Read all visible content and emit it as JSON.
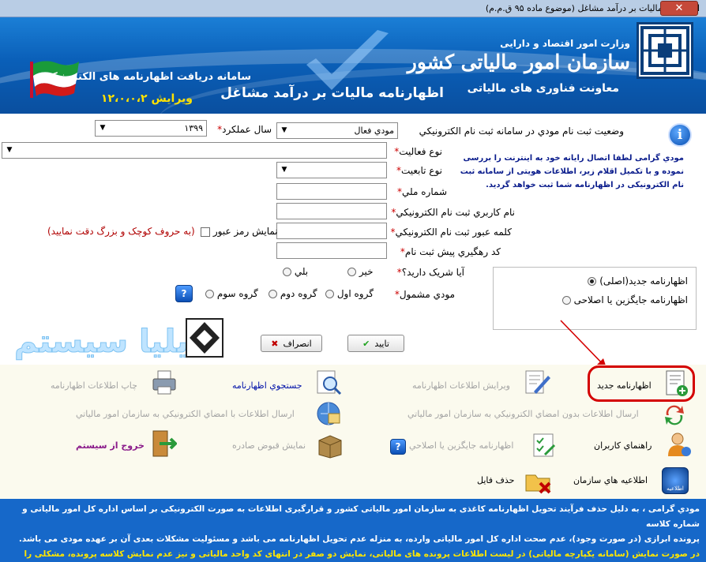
{
  "window": {
    "title": "اظهارنامه ماليات بر درآمد مشاغل (موضوع ماده ۹۵ ق.م.م)",
    "close_label": "✕"
  },
  "banner": {
    "ministry": "وزارت امور اقتصاد و دارایی",
    "org": "سازمان امور مالیاتی کشور",
    "dept": "معاونت فناوری های مالیاتی",
    "form_title": "اظهارنامه مالیات بر درآمد مشاغل",
    "system_name": "سامانه دریافت اظهارنامه های الکترونیک",
    "version": "ویرایش ۱۲،۰،۰،۲"
  },
  "form": {
    "status_label": "وضعيت ثبت نام مودي در سامانه ثبت نام الكترونيكي",
    "status_value": "مودي فعال",
    "year_label": "سال عملکرد",
    "year_value": "۱۳۹۹",
    "activity_label": "نوع فعاليت",
    "nationality_label": "نوع تابعيت",
    "national_id_label": "شماره ملي",
    "username_label": "نام كاربري ثبت نام الكترونيكي",
    "password_label": "كلمه عبور ثبت نام الكترونيكي",
    "show_password_label": "نمايش رمز عبور",
    "case_hint": "(به حروف كوچک و بزرگ دقت نماييد)",
    "tracking_label": "كد رهگيري پيش ثبت نام",
    "partner_label": "آيا شريک داريد؟",
    "partner_no": "خير",
    "partner_yes": "بلي",
    "group_label": "مودي مشمول",
    "group_1": "گروه اول",
    "group_2": "گروه دوم",
    "group_3": "گروه سوم",
    "help_icon": "question-icon",
    "required_mark": "*"
  },
  "notice": {
    "info_glyph": "i",
    "text": "مودي گرامی لطفا اتصال رايانه خود به اينترنت را بررسی نموده و با تكميل اقلام زير، اطلاعات هويتی از سامانه ثبت نام الكترونيكی در اظهارنامه شما ثبت خواهد گرديد."
  },
  "return_type": {
    "option_new": "اظهارنامه جديد(اصلی)",
    "option_replace": "اظهارنامه جايگزين يا اصلاحی",
    "selected": "new"
  },
  "buttons": {
    "confirm": "تاييد",
    "cancel": "انصراف"
  },
  "watermark_text": "ایلیا سیستم",
  "actions": {
    "new_return": "اظهارنامه جديد",
    "edit_info": "ويرايش اطلاعات اظهارنامه",
    "search_return": "جستجوي اظهارنامه",
    "print_info": "چاپ اطلاعات اظهارنامه",
    "send_unsigned": "ارسال اطلاعات بدون امضاي الكترونيكي به سازمان امور مالياتي",
    "send_signed": "ارسال اطلاعات با امضاي الكترونيكي به سازمان امور مالياتي",
    "user_guide": "راهنماي كاربران",
    "replace_return": "اظهارنامه جايگزين يا اصلاحي",
    "show_receipts": "نمايش قبوض صادره",
    "exit": "خروج از سيستم",
    "announcements": "اطلاعيه هاي سازمان",
    "delete_file": "حذف فايل",
    "announce_badge": "اطلاعيه"
  },
  "footer": {
    "line1": "مودي گرامی ، به دليل حذف فرآيند تحويل اظهارنامه كاغذی به سازمان امور مالياتی كشور و قرارگيری اطلاعات به صورت الكترونيكی بر اساس اداره كل امور مالياتی و شماره كلاسه",
    "line2": "پرونده ابرازی (در صورت وجود)، عدم صحت اداره كل امور مالياتی وارده، به منزله عدم تحويل اظهارنامه می باشد و مسئوليت مشكلات بعدی آن بر عهده مودی می باشد.",
    "line3": "در صورت نمايش (سامانه يكپارچه مالياتی) در ليست اطلاعات پرونده های مالياتی، نمايش دو صفر در انتهای كد واحد مالياتی و نيز عدم نمايش كلاسه پرونده، مشكلی را ايجاد نمی نمايد."
  },
  "colors": {
    "banner": "#0a5fb8",
    "footer": "#1668c9",
    "highlight": "#d40000",
    "yellow": "#ffe600"
  }
}
